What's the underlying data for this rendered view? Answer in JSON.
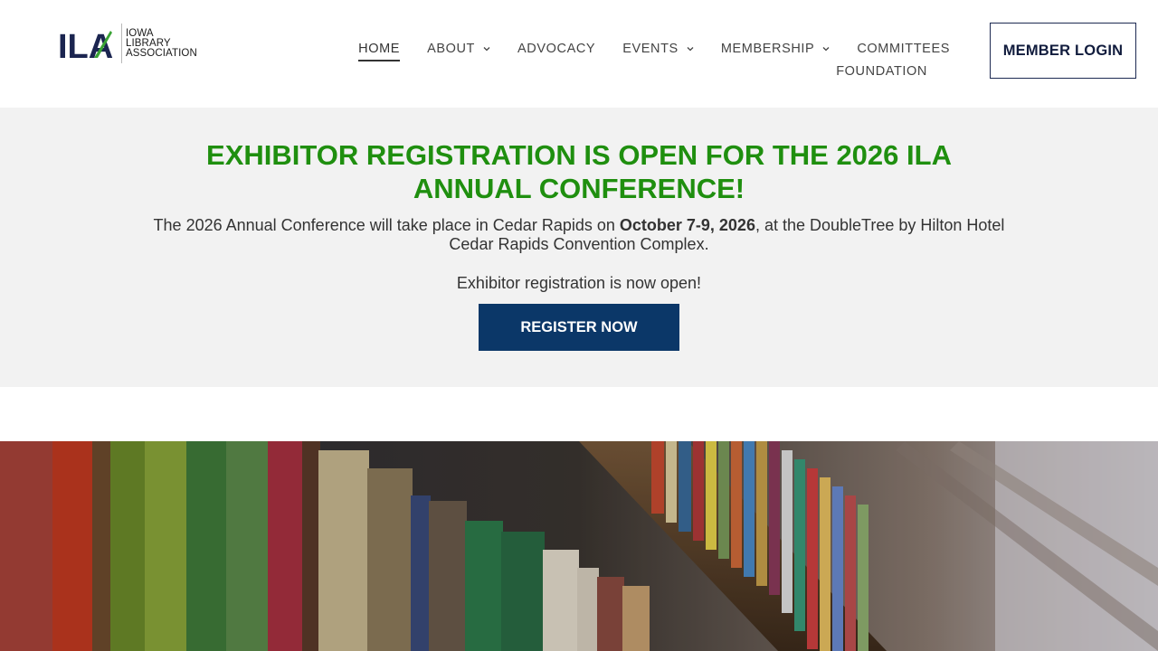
{
  "header": {
    "logo": {
      "mark_text": "ILA",
      "text_lines": [
        "IOWA",
        "LIBRARY",
        "ASSOCIATION"
      ]
    },
    "nav": [
      {
        "label": "HOME",
        "active": true,
        "dropdown": false
      },
      {
        "label": "ABOUT",
        "active": false,
        "dropdown": true
      },
      {
        "label": "ADVOCACY",
        "active": false,
        "dropdown": false
      },
      {
        "label": "EVENTS",
        "active": false,
        "dropdown": true
      },
      {
        "label": "MEMBERSHIP",
        "active": false,
        "dropdown": true
      },
      {
        "label": "COMMITTEES",
        "active": false,
        "dropdown": false
      },
      {
        "label": "FOUNDATION",
        "active": false,
        "dropdown": false
      }
    ],
    "login_label": "MEMBER LOGIN"
  },
  "banner": {
    "title": "EXHIBITOR REGISTRATION IS OPEN FOR THE 2026 ILA ANNUAL CONFERENCE!",
    "desc_before": "The 2026 Annual Conference will take place in Cedar Rapids on ",
    "desc_bold": "October 7-9, 2026",
    "desc_after": ", at the DoubleTree by Hilton Hotel Cedar Rapids Convention Complex.",
    "open_text": "Exhibitor registration is now open!",
    "button_label": "REGISTER NOW"
  },
  "colors": {
    "title_green": "#1f8f0f",
    "button_navy": "#0b3768",
    "login_border": "#1d2a52",
    "banner_bg": "#f2f2f2"
  },
  "hero": {
    "icon": "library-bookshelf-image"
  }
}
